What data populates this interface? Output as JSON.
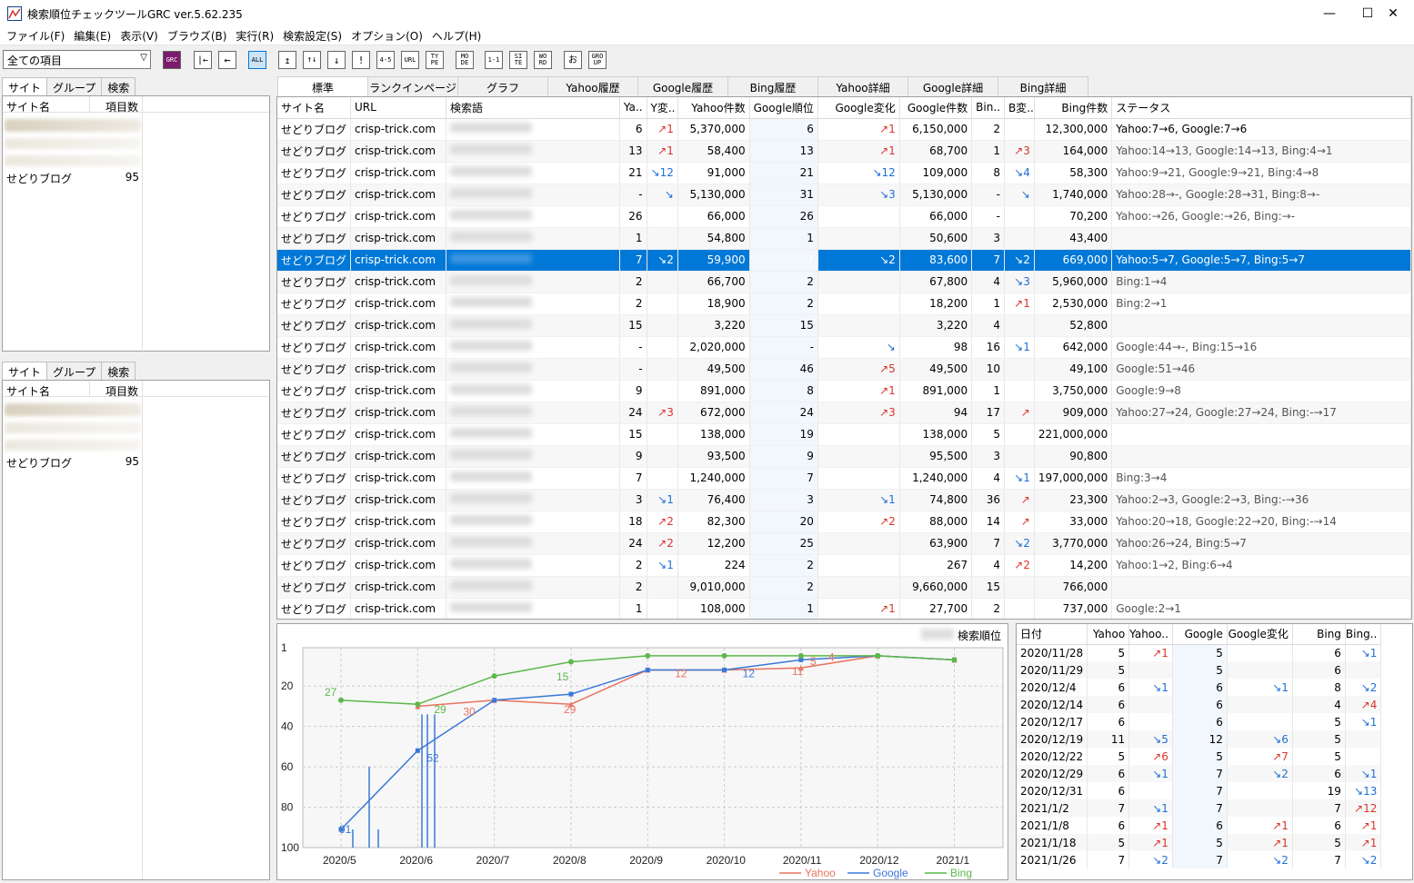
{
  "window": {
    "title": "検索順位チェックツールGRC  ver.5.62.235",
    "min": "—",
    "max": "☐",
    "close": "✕"
  },
  "menu": [
    "ファイル(F)",
    "編集(E)",
    "表示(V)",
    "ブラウズ(B)",
    "実行(R)",
    "検索設定(S)",
    "オプション(O)",
    "ヘルプ(H)"
  ],
  "toolbar": {
    "combo_value": "全ての項目",
    "buttons": [
      "GRC",
      "|←",
      "←",
      "ALL",
      "↥",
      "↑↓",
      "↓",
      "!",
      "4-5",
      "URL",
      "TY PE",
      "MO DE",
      "1-1",
      "SI TE",
      "WO RD",
      "お",
      "GRO UP"
    ]
  },
  "left_top": {
    "tabs": [
      "サイト",
      "グループ",
      "検索"
    ],
    "headers": [
      "サイト名",
      "項目数"
    ],
    "rows": [
      {
        "name": "",
        "count": "",
        "blur": true
      },
      {
        "name": "",
        "count": "",
        "blur": true
      },
      {
        "name": "",
        "count": "",
        "blur": true
      },
      {
        "name": "せどりブログ",
        "count": "95",
        "blur": false
      }
    ]
  },
  "left_bottom": {
    "tabs": [
      "サイト",
      "グループ",
      "検索"
    ],
    "headers": [
      "サイト名",
      "項目数"
    ],
    "rows": [
      {
        "name": "",
        "count": "",
        "blur": true
      },
      {
        "name": "",
        "count": "",
        "blur": true
      },
      {
        "name": "",
        "count": "",
        "blur": true
      },
      {
        "name": "せどりブログ",
        "count": "95",
        "blur": false
      }
    ]
  },
  "main_tabs": [
    "標準",
    "ランクインページ",
    "グラフ",
    "Yahoo履歴",
    "Google履歴",
    "Bing履歴",
    "Yahoo詳細",
    "Google詳細",
    "Bing詳細"
  ],
  "grid": {
    "headers": [
      "サイト名",
      "URL",
      "検索語",
      "Ya..",
      "Y変..",
      "Yahoo件数",
      "Google順位",
      "Google変化",
      "Google件数",
      "Bin..",
      "B変..",
      "Bing件数",
      "ステータス"
    ],
    "rows": [
      [
        "せどりブログ",
        "crisp-trick.com",
        "",
        "6",
        "↗1",
        "5,370,000",
        "6",
        "↗1",
        "6,150,000",
        "2",
        "",
        "12,300,000",
        "Yahoo:7→6, Google:7→6"
      ],
      [
        "せどりブログ",
        "crisp-trick.com",
        "",
        "13",
        "↗1",
        "58,400",
        "13",
        "↗1",
        "68,700",
        "1",
        "↗3",
        "164,000",
        "Yahoo:14→13, Google:14→13, Bing:4→1"
      ],
      [
        "せどりブログ",
        "crisp-trick.com",
        "",
        "21",
        "↘12",
        "91,000",
        "21",
        "↘12",
        "109,000",
        "8",
        "↘4",
        "58,300",
        "Yahoo:9→21, Google:9→21, Bing:4→8"
      ],
      [
        "せどりブログ",
        "crisp-trick.com",
        "",
        "-",
        "↘",
        "5,130,000",
        "31",
        "↘3",
        "5,130,000",
        "-",
        "↘",
        "1,740,000",
        "Yahoo:28→-, Google:28→31, Bing:8→-"
      ],
      [
        "せどりブログ",
        "crisp-trick.com",
        "",
        "26",
        "",
        "66,000",
        "26",
        "",
        "66,000",
        "-",
        "",
        "70,200",
        "Yahoo:→26, Google:→26, Bing:→-"
      ],
      [
        "せどりブログ",
        "crisp-trick.com",
        "",
        "1",
        "",
        "54,800",
        "1",
        "",
        "50,600",
        "3",
        "",
        "43,400",
        ""
      ],
      [
        "せどりブログ",
        "crisp-trick.com",
        "",
        "7",
        "↘2",
        "59,900",
        "7",
        "↘2",
        "83,600",
        "7",
        "↘2",
        "669,000",
        "Yahoo:5→7, Google:5→7, Bing:5→7"
      ],
      [
        "せどりブログ",
        "crisp-trick.com",
        "",
        "2",
        "",
        "66,700",
        "2",
        "",
        "67,800",
        "4",
        "↘3",
        "5,960,000",
        "Bing:1→4"
      ],
      [
        "せどりブログ",
        "crisp-trick.com",
        "",
        "2",
        "",
        "18,900",
        "2",
        "",
        "18,200",
        "1",
        "↗1",
        "2,530,000",
        "Bing:2→1"
      ],
      [
        "せどりブログ",
        "crisp-trick.com",
        "",
        "15",
        "",
        "3,220",
        "15",
        "",
        "3,220",
        "4",
        "",
        "52,800",
        ""
      ],
      [
        "せどりブログ",
        "crisp-trick.com",
        "",
        "-",
        "",
        "2,020,000",
        "-",
        "↘",
        "98",
        "16",
        "↘1",
        "642,000",
        "Google:44→-, Bing:15→16"
      ],
      [
        "せどりブログ",
        "crisp-trick.com",
        "",
        "-",
        "",
        "49,500",
        "46",
        "↗5",
        "49,500",
        "10",
        "",
        "49,100",
        "Google:51→46"
      ],
      [
        "せどりブログ",
        "crisp-trick.com",
        "",
        "9",
        "",
        "891,000",
        "8",
        "↗1",
        "891,000",
        "1",
        "",
        "3,750,000",
        "Google:9→8"
      ],
      [
        "せどりブログ",
        "crisp-trick.com",
        "",
        "24",
        "↗3",
        "672,000",
        "24",
        "↗3",
        "94",
        "17",
        "↗",
        "909,000",
        "Yahoo:27→24, Google:27→24, Bing:-→17"
      ],
      [
        "せどりブログ",
        "crisp-trick.com",
        "",
        "15",
        "",
        "138,000",
        "19",
        "",
        "138,000",
        "5",
        "",
        "221,000,000",
        ""
      ],
      [
        "せどりブログ",
        "crisp-trick.com",
        "",
        "9",
        "",
        "93,500",
        "9",
        "",
        "95,500",
        "3",
        "",
        "90,800",
        ""
      ],
      [
        "せどりブログ",
        "crisp-trick.com",
        "",
        "7",
        "",
        "1,240,000",
        "7",
        "",
        "1,240,000",
        "4",
        "↘1",
        "197,000,000",
        "Bing:3→4"
      ],
      [
        "せどりブログ",
        "crisp-trick.com",
        "",
        "3",
        "↘1",
        "76,400",
        "3",
        "↘1",
        "74,800",
        "36",
        "↗",
        "23,300",
        "Yahoo:2→3, Google:2→3, Bing:-→36"
      ],
      [
        "せどりブログ",
        "crisp-trick.com",
        "",
        "18",
        "↗2",
        "82,300",
        "20",
        "↗2",
        "88,000",
        "14",
        "↗",
        "33,000",
        "Yahoo:20→18, Google:22→20, Bing:-→14"
      ],
      [
        "せどりブログ",
        "crisp-trick.com",
        "",
        "24",
        "↗2",
        "12,200",
        "25",
        "",
        "63,900",
        "7",
        "↘2",
        "3,770,000",
        "Yahoo:26→24, Bing:5→7"
      ],
      [
        "せどりブログ",
        "crisp-trick.com",
        "",
        "2",
        "↘1",
        "224",
        "2",
        "",
        "267",
        "4",
        "↗2",
        "14,200",
        "Yahoo:1→2, Bing:6→4"
      ],
      [
        "せどりブログ",
        "crisp-trick.com",
        "",
        "2",
        "",
        "9,010,000",
        "2",
        "",
        "9,660,000",
        "15",
        "",
        "766,000",
        ""
      ],
      [
        "せどりブログ",
        "crisp-trick.com",
        "",
        "1",
        "",
        "108,000",
        "1",
        "↗1",
        "27,700",
        "2",
        "",
        "737,000",
        "Google:2→1"
      ]
    ],
    "selected_index": 6
  },
  "chart": {
    "legend_label": "検索順位",
    "yticks": [
      "1",
      "20",
      "40",
      "60",
      "80",
      "100"
    ],
    "xticks": [
      "2020/5",
      "2020/6",
      "2020/7",
      "2020/8",
      "2020/9",
      "2020/10",
      "2020/11",
      "2020/12",
      "2021/1"
    ],
    "legend": [
      "Yahoo",
      "Google",
      "Bing"
    ],
    "colors": {
      "yahoo": "#e8735f",
      "google": "#3a78d8",
      "bing": "#5cb84a"
    },
    "labels": [
      {
        "t": "27",
        "c": "bing"
      },
      {
        "t": "29",
        "c": "bing"
      },
      {
        "t": "15",
        "c": "bing"
      },
      {
        "t": "30",
        "c": "yahoo"
      },
      {
        "t": "29",
        "c": "yahoo"
      },
      {
        "t": "52",
        "c": "google"
      },
      {
        "t": "91",
        "c": "google"
      },
      {
        "t": "12",
        "c": "yahoo"
      },
      {
        "t": "12",
        "c": "google"
      },
      {
        "t": "11",
        "c": "yahoo"
      },
      {
        "t": "5",
        "c": "yahoo"
      },
      {
        "t": "7",
        "c": "yahoo"
      },
      {
        "t": "4",
        "c": "yahoo"
      }
    ]
  },
  "chart_data": {
    "type": "line",
    "title": "検索順位",
    "ylim": [
      100,
      1
    ],
    "x": [
      "2020/5",
      "2020/6",
      "2020/7",
      "2020/8",
      "2020/9",
      "2020/10",
      "2020/11",
      "2020/12",
      "2021/1"
    ],
    "series": [
      {
        "name": "Yahoo",
        "values": [
          null,
          30,
          27,
          29,
          12,
          12,
          11,
          5,
          7
        ]
      },
      {
        "name": "Google",
        "values": [
          91,
          52,
          27,
          24,
          12,
          12,
          7,
          5,
          7
        ]
      },
      {
        "name": "Bing",
        "values": [
          27,
          29,
          15,
          8,
          5,
          5,
          5,
          5,
          7
        ]
      }
    ]
  },
  "history": {
    "headers": [
      "日付",
      "Yahoo",
      "Yahoo..",
      "Google",
      "Google変化",
      "Bing",
      "Bing.."
    ],
    "rows": [
      [
        "2020/11/28",
        "5",
        "↗1",
        "5",
        "",
        "6",
        "↘1"
      ],
      [
        "2020/11/29",
        "5",
        "",
        "5",
        "",
        "6",
        ""
      ],
      [
        "2020/12/4",
        "6",
        "↘1",
        "6",
        "↘1",
        "8",
        "↘2"
      ],
      [
        "2020/12/14",
        "6",
        "",
        "6",
        "",
        "4",
        "↗4"
      ],
      [
        "2020/12/17",
        "6",
        "",
        "6",
        "",
        "5",
        "↘1"
      ],
      [
        "2020/12/19",
        "11",
        "↘5",
        "12",
        "↘6",
        "5",
        ""
      ],
      [
        "2020/12/22",
        "5",
        "↗6",
        "5",
        "↗7",
        "5",
        ""
      ],
      [
        "2020/12/29",
        "6",
        "↘1",
        "7",
        "↘2",
        "6",
        "↘1"
      ],
      [
        "2020/12/31",
        "6",
        "",
        "7",
        "",
        "19",
        "↘13"
      ],
      [
        "2021/1/2",
        "7",
        "↘1",
        "7",
        "",
        "7",
        "↗12"
      ],
      [
        "2021/1/8",
        "6",
        "↗1",
        "6",
        "↗1",
        "6",
        "↗1"
      ],
      [
        "2021/1/18",
        "5",
        "↗1",
        "5",
        "↗1",
        "5",
        "↗1"
      ],
      [
        "2021/1/26",
        "7",
        "↘2",
        "7",
        "↘2",
        "7",
        "↘2"
      ]
    ]
  }
}
